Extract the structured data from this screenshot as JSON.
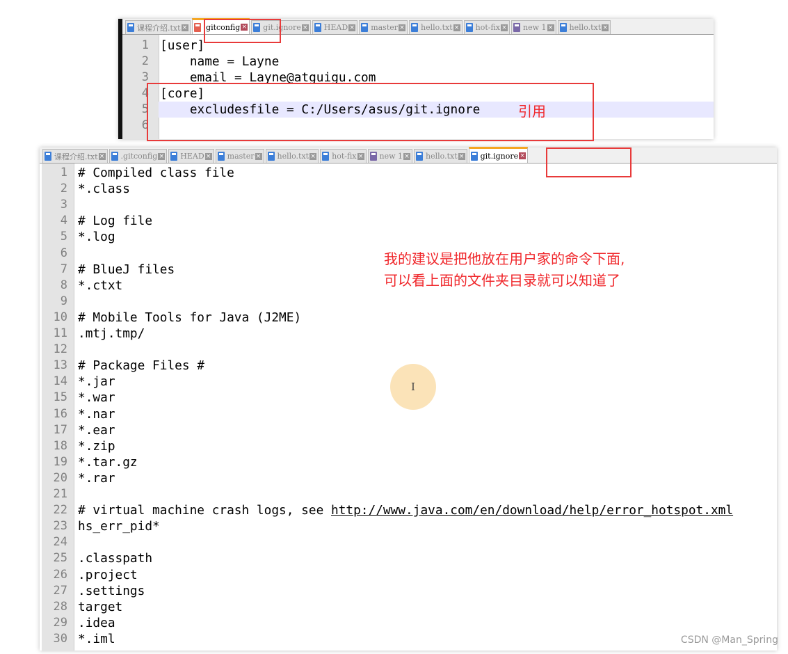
{
  "top_editor": {
    "tabs": [
      {
        "label": "课程介绍.txt",
        "icon": "blue"
      },
      {
        "label": ".gitconfig",
        "icon": "red",
        "active": true
      },
      {
        "label": "git.ignore",
        "icon": "blue"
      },
      {
        "label": "HEAD",
        "icon": "blue"
      },
      {
        "label": "master",
        "icon": "blue"
      },
      {
        "label": "hello.txt",
        "icon": "blue"
      },
      {
        "label": "hot-fix",
        "icon": "blue"
      },
      {
        "label": "new 1",
        "icon": "purple"
      },
      {
        "label": "hello.txt",
        "icon": "blue"
      }
    ],
    "lines": [
      "[user]",
      "    name = Layne",
      "    email = Layne@atguigu.com",
      "[core]",
      "    excludesfile = C:/Users/asus/git.ignore",
      ""
    ],
    "highlighted_line": 5,
    "annotation": "引用"
  },
  "bottom_editor": {
    "tabs": [
      {
        "label": "课程介绍.txt",
        "icon": "blue"
      },
      {
        "label": ".gitconfig",
        "icon": "blue"
      },
      {
        "label": "HEAD",
        "icon": "blue"
      },
      {
        "label": "master",
        "icon": "blue"
      },
      {
        "label": "hello.txt",
        "icon": "blue"
      },
      {
        "label": "hot-fix",
        "icon": "blue"
      },
      {
        "label": "new 1",
        "icon": "purple"
      },
      {
        "label": "hello.txt",
        "icon": "blue"
      },
      {
        "label": "git.ignore",
        "icon": "blue",
        "active": true
      }
    ],
    "lines": [
      "# Compiled class file",
      "*.class",
      "",
      "# Log file",
      "*.log",
      "",
      "# BlueJ files",
      "*.ctxt",
      "",
      "# Mobile Tools for Java (J2ME)",
      ".mtj.tmp/",
      "",
      "# Package Files #",
      "*.jar",
      "*.war",
      "*.nar",
      "*.ear",
      "*.zip",
      "*.tar.gz",
      "*.rar",
      "",
      "# virtual machine crash logs, see ",
      "hs_err_pid*",
      "",
      ".classpath",
      ".project",
      ".settings",
      "target",
      ".idea",
      "*.iml"
    ],
    "link_line": 22,
    "link": "http://www.java.com/en/download/help/error_hotspot.xml",
    "annotation": [
      "我的建议是把他放在用户家的命令下面,",
      "可以看上面的文件夹目录就可以知道了"
    ]
  },
  "cursor_glyph": "I",
  "watermark": "CSDN @Man_Spring",
  "colors": {
    "annotation": "#f0282c",
    "active_tab_accent": "#f5a623",
    "highlight_line": "#e8e8ff"
  }
}
